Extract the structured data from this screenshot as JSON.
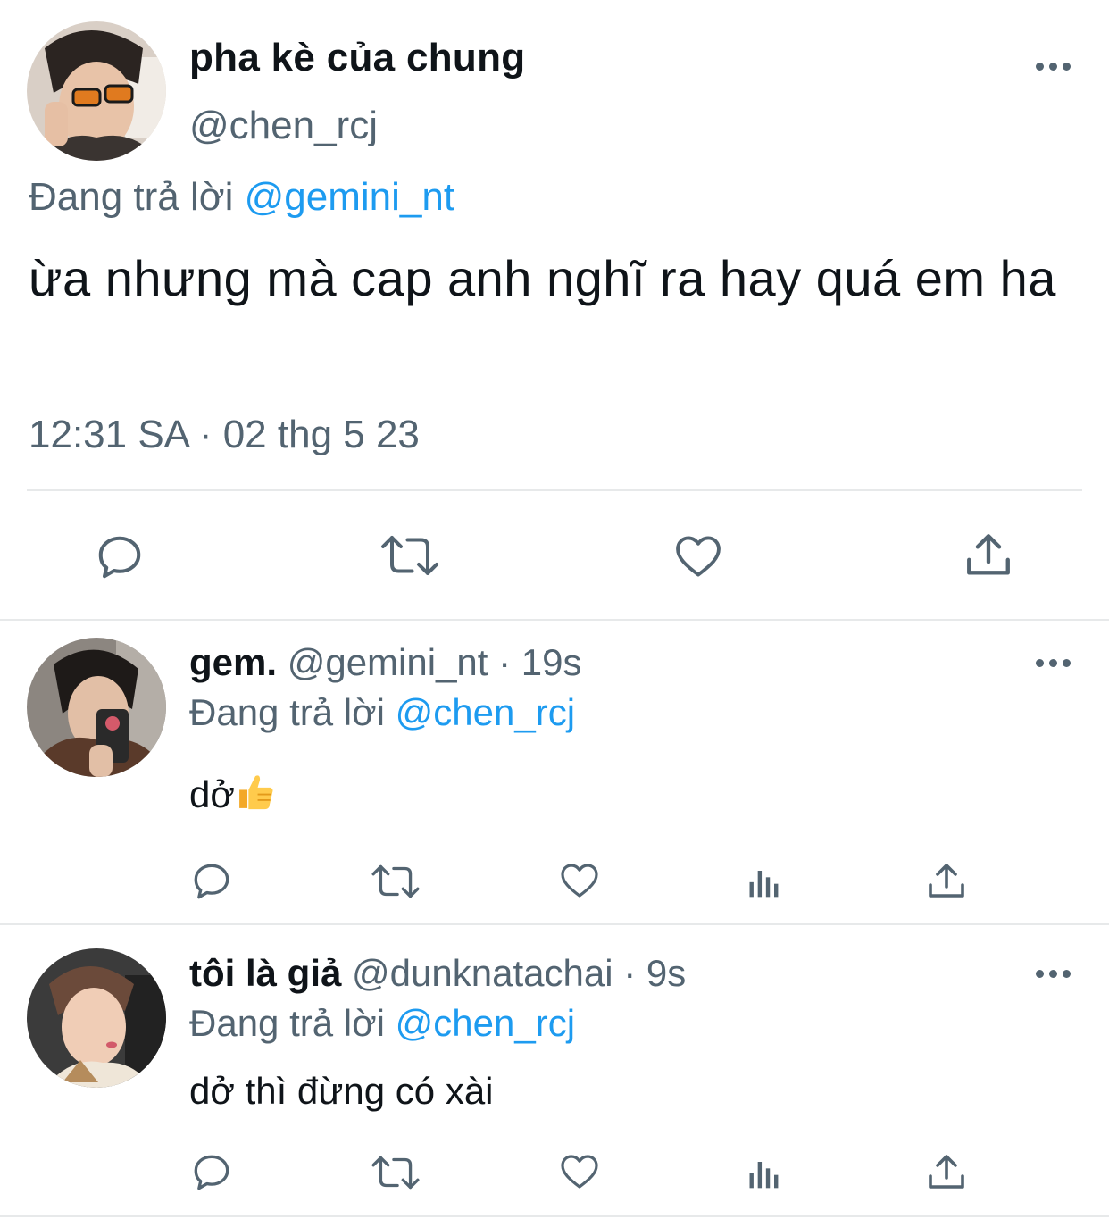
{
  "main_tweet": {
    "name": "pha kè của chung",
    "handle": "@chen_rcj",
    "replying_label": "Đang trả lời",
    "replying_to": "@gemini_nt",
    "text": "ừa nhưng mà cap anh nghĩ ra hay quá em ha",
    "timestamp": "12:31 SA · 02 thg 5 23",
    "actions": [
      "reply-icon",
      "retweet-icon",
      "like-icon",
      "share-icon"
    ]
  },
  "replies": [
    {
      "name": "gem.",
      "handle": "@gemini_nt",
      "time": "· 19s",
      "replying_label": "Đang trả lời",
      "replying_to": "@chen_rcj",
      "text": "dở",
      "emoji": "thumbs-up-emoji",
      "actions": [
        "reply-icon",
        "retweet-icon",
        "like-icon",
        "analytics-icon",
        "share-icon"
      ]
    },
    {
      "name": "tôi là giả",
      "handle": "@dunknatachai",
      "time": "· 9s",
      "replying_label": "Đang trả lời",
      "replying_to": "@chen_rcj",
      "text": "dở thì đừng có xài",
      "actions": [
        "reply-icon",
        "retweet-icon",
        "like-icon",
        "analytics-icon",
        "share-icon"
      ]
    }
  ],
  "colors": {
    "text": "#0f1419",
    "muted": "#536471",
    "link": "#1d9bf0",
    "divider": "#e7e9ea"
  }
}
